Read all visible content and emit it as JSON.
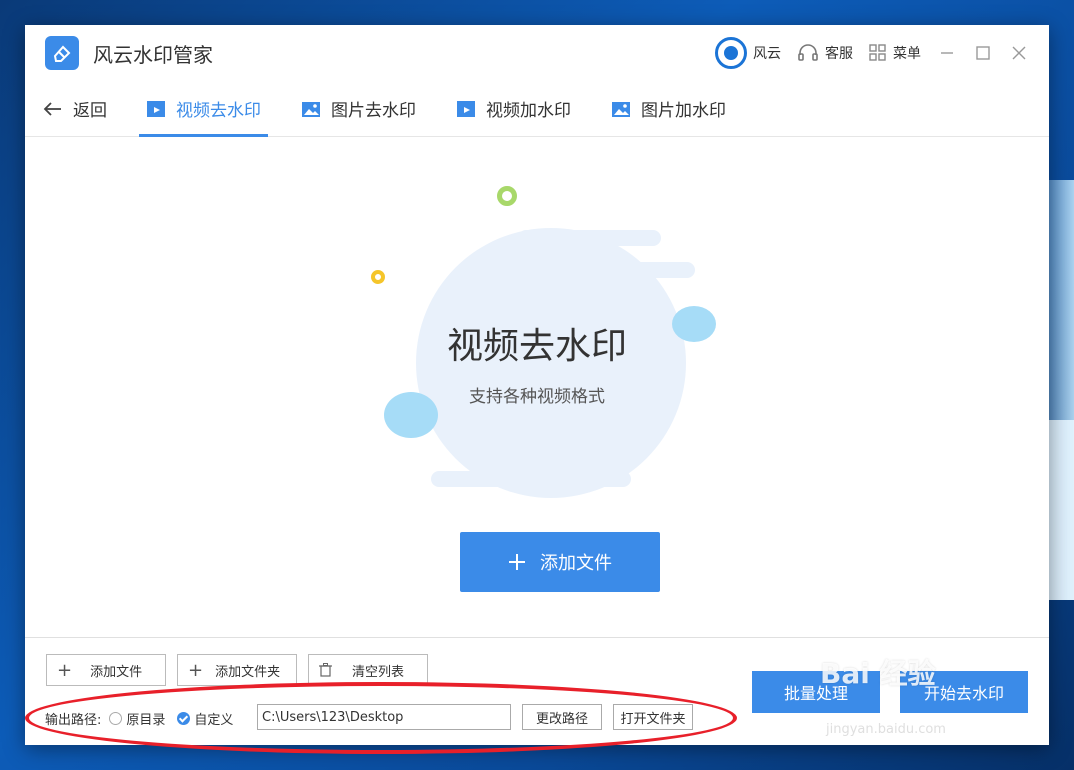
{
  "app": {
    "title": "风云水印管家"
  },
  "titlebar": {
    "user_label": "风云",
    "service_label": "客服",
    "menu_label": "菜单"
  },
  "nav": {
    "back_label": "返回",
    "tabs": [
      {
        "label": "视频去水印",
        "active": true
      },
      {
        "label": "图片去水印",
        "active": false
      },
      {
        "label": "视频加水印",
        "active": false
      },
      {
        "label": "图片加水印",
        "active": false
      }
    ]
  },
  "hero": {
    "title": "视频去水印",
    "subtitle": "支持各种视频格式",
    "add_button": "添加文件"
  },
  "footer": {
    "add_file": "添加文件",
    "add_folder": "添加文件夹",
    "clear_list": "清空列表",
    "output_label": "输出路径:",
    "option_original": "原目录",
    "option_custom": "自定义",
    "selected_option": "自定义",
    "path_value": "C:\\Users\\123\\Desktop",
    "change_path": "更改路径",
    "open_folder": "打开文件夹",
    "batch_process": "批量处理",
    "start_remove": "开始去水印"
  },
  "overlay": {
    "watermark": "Bai 经验",
    "watermark_sub": "jingyan.baidu.com"
  },
  "colors": {
    "accent": "#3b8be8",
    "annotation": "#e8202a"
  }
}
